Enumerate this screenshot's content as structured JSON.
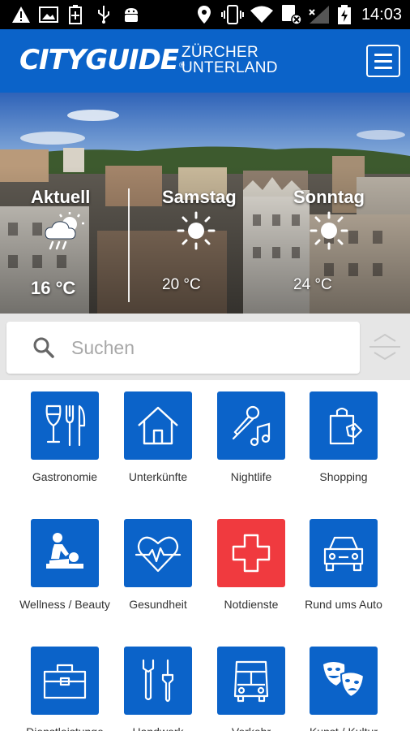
{
  "status_bar": {
    "time": "14:03",
    "icons": [
      "warning-icon",
      "image-icon",
      "battery-saver-icon",
      "usb-icon",
      "android-debug-icon",
      "location-icon",
      "vibrate-icon",
      "wifi-icon",
      "data-off-icon",
      "signal-icon",
      "battery-charging-icon"
    ]
  },
  "header": {
    "logo_text": "CITYGUIDE",
    "logo_registered": "®",
    "region_line1": "ZÜRCHER",
    "region_line2": "UNTERLAND",
    "menu_icon": "hamburger-menu-icon",
    "brand_color": "#0b63c9"
  },
  "weather": {
    "days": [
      {
        "label": "Aktuell",
        "temp": "16 °C",
        "icon": "cloud-rain-sun-icon"
      },
      {
        "label": "Samstag",
        "temp": "20 °C",
        "icon": "sun-icon"
      },
      {
        "label": "Sonntag",
        "temp": "24 °C",
        "icon": "sun-icon"
      }
    ]
  },
  "search": {
    "placeholder": "Suchen",
    "icon": "search-icon",
    "handle_icon": "reorder-handle-icon"
  },
  "categories": [
    {
      "label": "Gastronomie",
      "icon": "wine-cutlery-icon",
      "color": "#0b63c9"
    },
    {
      "label": "Unterkünfte",
      "icon": "house-icon",
      "color": "#0b63c9"
    },
    {
      "label": "Nightlife",
      "icon": "microphone-music-icon",
      "color": "#0b63c9"
    },
    {
      "label": "Shopping",
      "icon": "shopping-bag-icon",
      "color": "#0b63c9"
    },
    {
      "label": "Wellness / Beauty",
      "icon": "massage-icon",
      "color": "#0b63c9"
    },
    {
      "label": "Gesundheit",
      "icon": "heartbeat-icon",
      "color": "#0b63c9"
    },
    {
      "label": "Notdienste",
      "icon": "emergency-cross-icon",
      "color": "#f03a3f"
    },
    {
      "label": "Rund ums Auto",
      "icon": "car-icon",
      "color": "#0b63c9"
    },
    {
      "label": "Dienstleistunge",
      "icon": "briefcase-icon",
      "color": "#0b63c9"
    },
    {
      "label": "Handwerk",
      "icon": "tools-icon",
      "color": "#0b63c9"
    },
    {
      "label": "Verkehr",
      "icon": "bus-icon",
      "color": "#0b63c9"
    },
    {
      "label": "Kunst / Kultur",
      "icon": "theatre-masks-icon",
      "color": "#0b63c9"
    }
  ]
}
